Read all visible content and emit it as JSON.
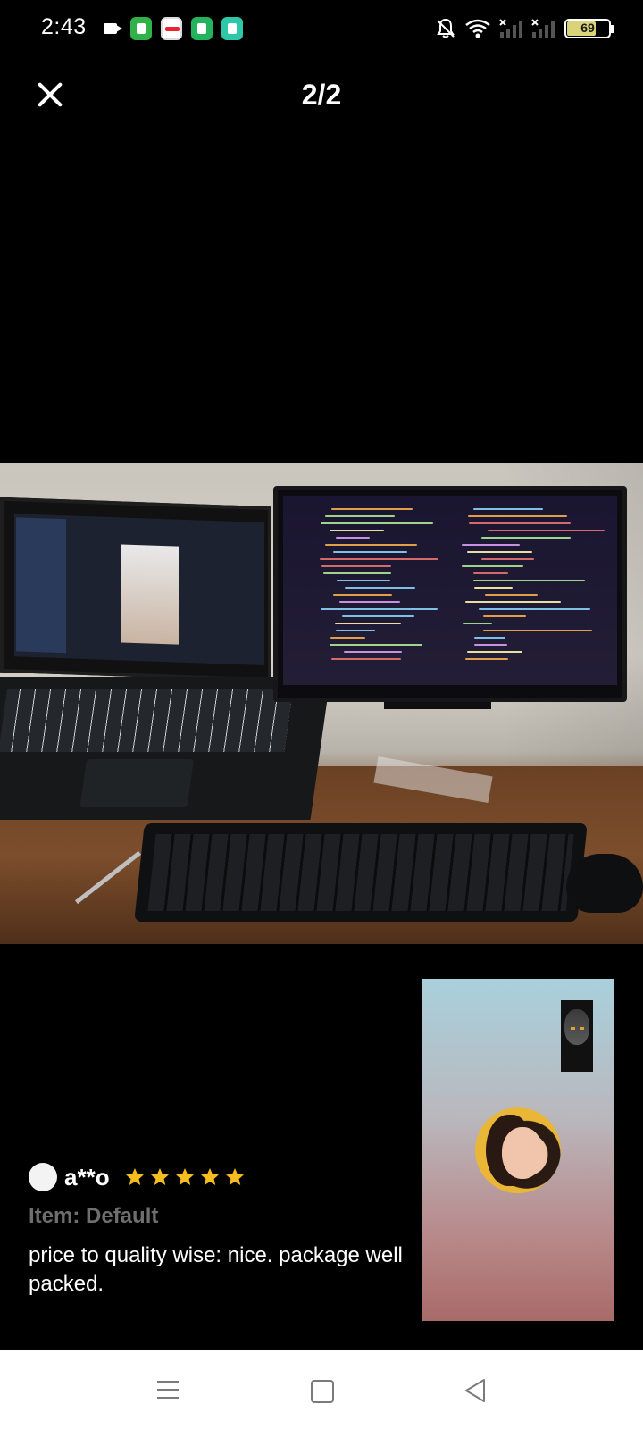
{
  "status_bar": {
    "time": "2:43",
    "battery_level": "69",
    "battery_fraction": 0.69,
    "icons": [
      "video-camera-icon",
      "app-store-icon",
      "lazada-app-icon",
      "shield-app-icon",
      "chat-app-icon",
      "bell-off-icon",
      "wifi-icon",
      "signal-icon",
      "signal-icon",
      "battery-icon"
    ]
  },
  "viewer": {
    "counter": "2/2",
    "close_icon": "close-icon"
  },
  "review": {
    "reviewer_name": "a**o",
    "rating": 5,
    "rating_max": 5,
    "item_variant": "Item: Default",
    "text": "price to quality wise: nice. package well packed."
  },
  "colors": {
    "star": "#f5bd1f",
    "variant_text": "#6e6e6e",
    "nav_bar_bg": "#ffffff"
  },
  "nav_bar": {
    "icons": [
      "menu-icon",
      "home-icon",
      "back-icon"
    ]
  }
}
